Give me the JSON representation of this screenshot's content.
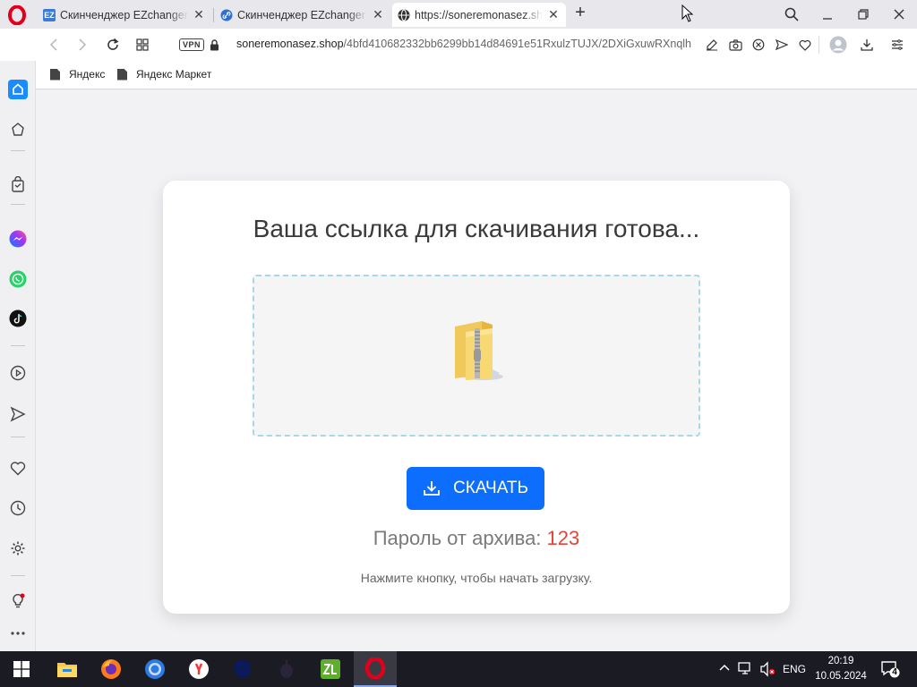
{
  "tabs": [
    {
      "label": "Скинченджер EZchanger",
      "favicon": "EZ"
    },
    {
      "label": "Скинченджер EZchanger",
      "favicon": "link-icon"
    },
    {
      "label": "https://soneremonasez.shop",
      "favicon": "globe-icon"
    }
  ],
  "toolbar": {
    "vpn_label": "VPN",
    "url_domain": "soneremonasez.shop",
    "url_path": "/4bfd410682332bb6299bb14d84691e51RxulzTUJX/2DXiGxuwRXnqlh"
  },
  "bookmarks": [
    {
      "label": "Яндекс"
    },
    {
      "label": "Яндекс Маркет"
    }
  ],
  "card": {
    "title": "Ваша ссылка для скачивания готова...",
    "button_label": "СКАЧАТЬ",
    "password_label": "Пароль от архива:",
    "password_value": "123",
    "hint": "Нажмите кнопку, чтобы начать загрузку."
  },
  "taskbar": {
    "lang": "ENG",
    "time": "20:19",
    "date": "10.05.2024",
    "notifications": "4"
  },
  "colors": {
    "accent": "#0d6efd",
    "password": "#e0463a",
    "opera": "#e0001b"
  }
}
